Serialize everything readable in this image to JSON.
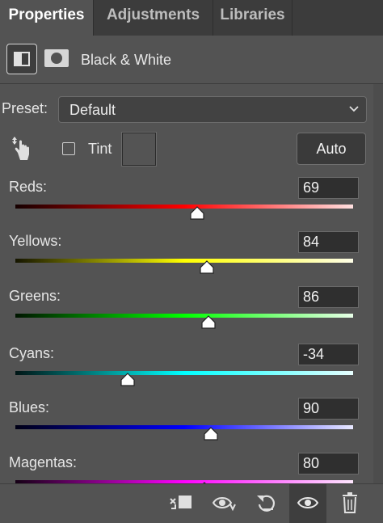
{
  "tabs": [
    {
      "label": "Properties",
      "active": true
    },
    {
      "label": "Adjustments",
      "active": false
    },
    {
      "label": "Libraries",
      "active": false
    }
  ],
  "header": {
    "title": "Black & White",
    "adjustment_icon": "black-white-adjustment-icon",
    "mask_icon": "layer-mask-icon"
  },
  "preset": {
    "label": "Preset:",
    "value": "Default"
  },
  "tint": {
    "label": "Tint",
    "checked": false
  },
  "auto_button": "Auto",
  "sliders": [
    {
      "label": "Reds:",
      "value": "69",
      "min": -200,
      "max": 300,
      "colors": [
        "#150000",
        "#ff0000",
        "#ffe0e0"
      ]
    },
    {
      "label": "Yellows:",
      "value": "84",
      "min": -200,
      "max": 300,
      "colors": [
        "#151500",
        "#ffff00",
        "#ffffe8"
      ]
    },
    {
      "label": "Greens:",
      "value": "86",
      "min": -200,
      "max": 300,
      "colors": [
        "#001500",
        "#00ff00",
        "#e8ffe8"
      ]
    },
    {
      "label": "Cyans:",
      "value": "-34",
      "min": -200,
      "max": 300,
      "colors": [
        "#001515",
        "#00ffff",
        "#e8ffff"
      ]
    },
    {
      "label": "Blues:",
      "value": "90",
      "min": -200,
      "max": 300,
      "colors": [
        "#000015",
        "#0000ff",
        "#e8e8ff"
      ]
    },
    {
      "label": "Magentas:",
      "value": "80",
      "min": -200,
      "max": 300,
      "colors": [
        "#150015",
        "#ff00ff",
        "#ffe8ff"
      ]
    }
  ],
  "footer_icons": [
    "clip-to-layer-icon",
    "view-previous-state-icon",
    "reset-icon",
    "visibility-eye-icon",
    "trash-icon"
  ]
}
